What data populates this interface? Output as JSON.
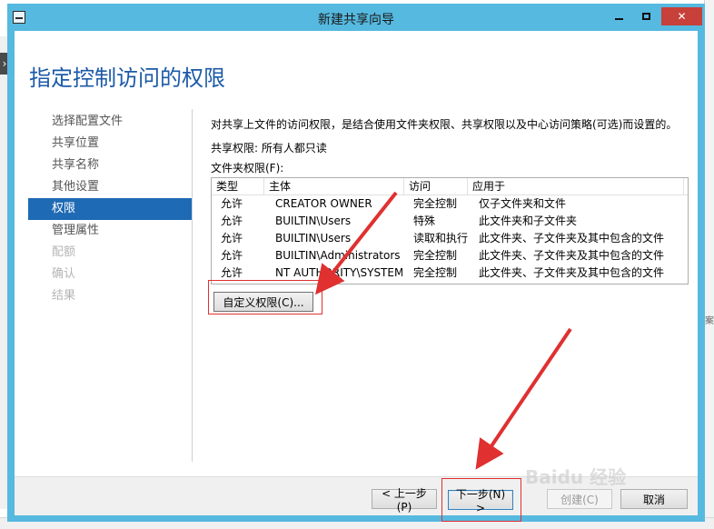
{
  "window": {
    "title": "新建共享向导",
    "page_title": "指定控制访问的权限"
  },
  "sidebar": {
    "items": [
      {
        "label": "选择配置文件",
        "state": "normal"
      },
      {
        "label": "共享位置",
        "state": "normal"
      },
      {
        "label": "共享名称",
        "state": "normal"
      },
      {
        "label": "其他设置",
        "state": "normal"
      },
      {
        "label": "权限",
        "state": "active"
      },
      {
        "label": "管理属性",
        "state": "normal"
      },
      {
        "label": "配额",
        "state": "disabled"
      },
      {
        "label": "确认",
        "state": "disabled"
      },
      {
        "label": "结果",
        "state": "disabled"
      }
    ]
  },
  "main": {
    "description": "对共享上文件的访问权限，是结合使用文件夹权限、共享权限以及中心访问策略(可选)而设置的。",
    "share_permissions": "共享权限: 所有人都只读",
    "folder_permissions_label": "文件夹权限(F):",
    "table": {
      "headers": [
        "类型",
        "主体",
        "访问",
        "应用于"
      ],
      "rows": [
        [
          "允许",
          "CREATOR OWNER",
          "完全控制",
          "仅子文件夹和文件"
        ],
        [
          "允许",
          "BUILTIN\\Users",
          "特殊",
          "此文件夹和子文件夹"
        ],
        [
          "允许",
          "BUILTIN\\Users",
          "读取和执行",
          "此文件夹、子文件夹及其中包含的文件"
        ],
        [
          "允许",
          "BUILTIN\\Administrators",
          "完全控制",
          "此文件夹、子文件夹及其中包含的文件"
        ],
        [
          "允许",
          "NT AUTHORITY\\SYSTEM",
          "完全控制",
          "此文件夹、子文件夹及其中包含的文件"
        ]
      ]
    },
    "custom_button": "自定义权限(C)..."
  },
  "footer": {
    "prev": "< 上一步(P)",
    "next": "下一步(N) >",
    "create": "创建(C)",
    "cancel": "取消"
  },
  "watermark": "Baidu 经验",
  "background": {
    "left_arrow": "›",
    "right_text": "案"
  },
  "colors": {
    "title_bar": "#56b9e0",
    "close_button": "#c7403a",
    "page_title": "#1c5aa8",
    "nav_active": "#1e6ab4",
    "annotation": "#e03030"
  }
}
